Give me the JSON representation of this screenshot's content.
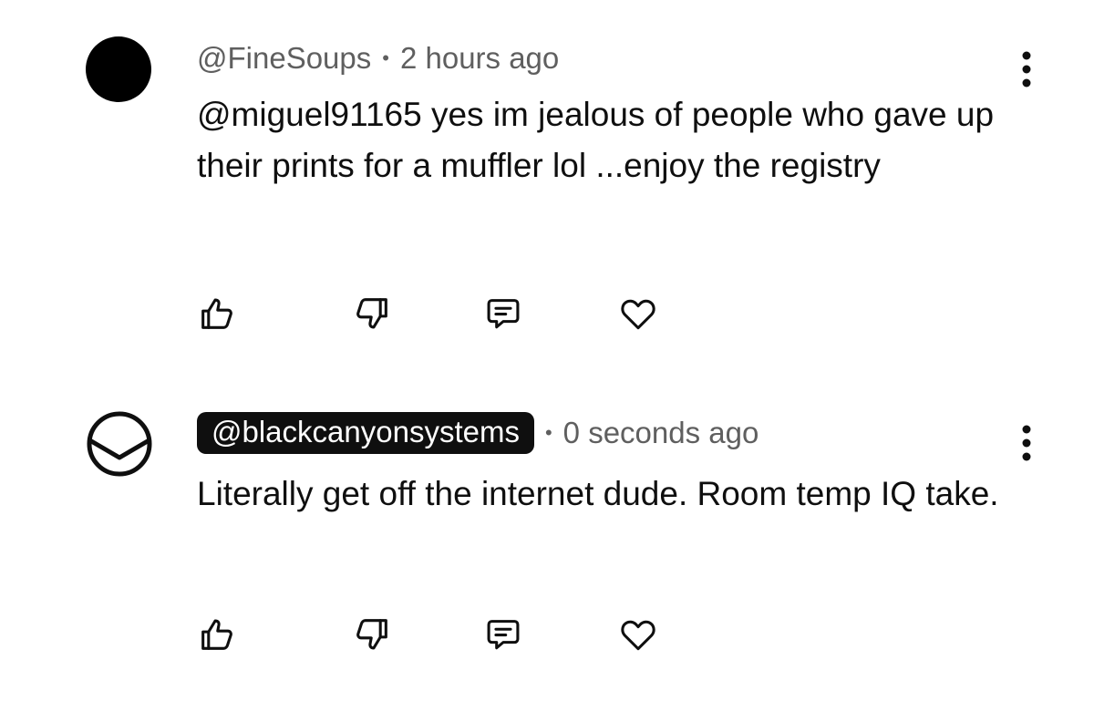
{
  "comments": [
    {
      "author": "@FineSoups",
      "author_highlighted": false,
      "separator": "•",
      "time": "2 hours ago",
      "text": "@miguel91165 yes im jealous of people who gave up their prints for a muffler lol ...enjoy the registry",
      "avatar_icon": "solid-black-avatar",
      "actions": [
        "thumbs-up-icon",
        "thumbs-down-icon",
        "reply-icon",
        "heart-icon"
      ]
    },
    {
      "author": "@blackcanyonsystems",
      "author_highlighted": true,
      "separator": "•",
      "time": "0 seconds ago",
      "text": "Literally get off the internet dude. Room temp IQ take.",
      "avatar_icon": "black-canyon-logo-avatar",
      "actions": [
        "thumbs-up-icon",
        "thumbs-down-icon",
        "reply-icon",
        "heart-icon"
      ]
    }
  ],
  "colors": {
    "text_primary": "#0f0f0f",
    "text_secondary": "#5f5f5f",
    "pill_background": "#0f0f0f",
    "pill_text": "#ffffff",
    "background": "#ffffff"
  }
}
